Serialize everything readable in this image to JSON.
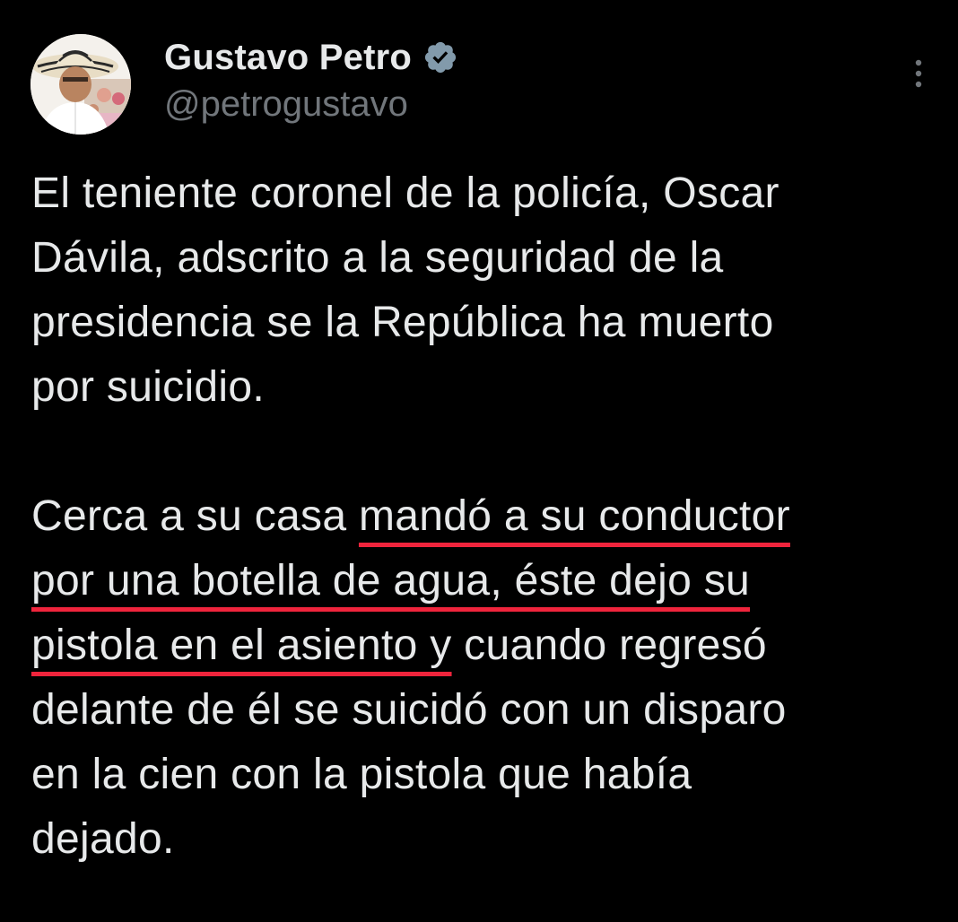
{
  "tweet": {
    "display_name": "Gustavo Petro",
    "handle": "@petrogustavo",
    "verified_icon": "verified-badge-icon",
    "more_icon": "more-options-icon",
    "avatar_icon": "profile-photo",
    "paragraph1": "El teniente coronel de la policía, Oscar\nDávila, adscrito a la seguridad de la\npresidencia se la República ha muerto\npor suicidio.",
    "paragraph2": {
      "before": "Cerca a su casa ",
      "underlined": "mandó a su conductor\npor una botella de agua, éste dejo su\npistola en el asiento y",
      "after": " cuando regresó\ndelante de él se suicidó con un disparo\nen la cien con la pistola que había\ndejado."
    }
  },
  "colors": {
    "background": "#000000",
    "text": "#e7e9ea",
    "handle": "#71767b",
    "verified": "#829aab",
    "underline": "#f0243c"
  }
}
